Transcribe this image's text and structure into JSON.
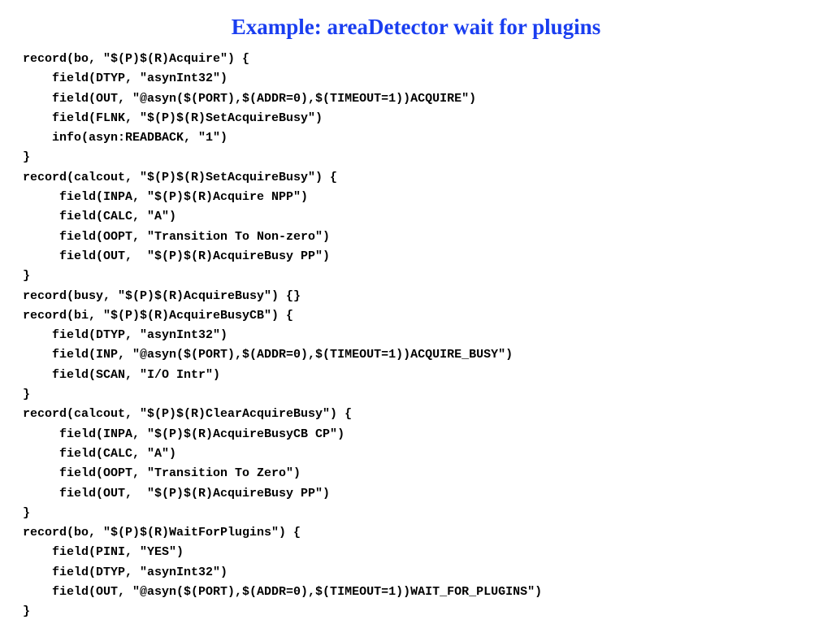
{
  "title": "Example: areaDetector wait for plugins",
  "code": "record(bo, \"$(P)$(R)Acquire\") {\n    field(DTYP, \"asynInt32\")\n    field(OUT, \"@asyn($(PORT),$(ADDR=0),$(TIMEOUT=1))ACQUIRE\")\n    field(FLNK, \"$(P)$(R)SetAcquireBusy\")\n    info(asyn:READBACK, \"1\")\n}\nrecord(calcout, \"$(P)$(R)SetAcquireBusy\") {\n     field(INPA, \"$(P)$(R)Acquire NPP\")\n     field(CALC, \"A\")\n     field(OOPT, \"Transition To Non-zero\")\n     field(OUT,  \"$(P)$(R)AcquireBusy PP\")\n}\nrecord(busy, \"$(P)$(R)AcquireBusy\") {}\nrecord(bi, \"$(P)$(R)AcquireBusyCB\") {\n    field(DTYP, \"asynInt32\")\n    field(INP, \"@asyn($(PORT),$(ADDR=0),$(TIMEOUT=1))ACQUIRE_BUSY\")\n    field(SCAN, \"I/O Intr\")\n}\nrecord(calcout, \"$(P)$(R)ClearAcquireBusy\") {\n     field(INPA, \"$(P)$(R)AcquireBusyCB CP\")\n     field(CALC, \"A\")\n     field(OOPT, \"Transition To Zero\")\n     field(OUT,  \"$(P)$(R)AcquireBusy PP\")\n}\nrecord(bo, \"$(P)$(R)WaitForPlugins\") {\n    field(PINI, \"YES\")\n    field(DTYP, \"asynInt32\")\n    field(OUT, \"@asyn($(PORT),$(ADDR=0),$(TIMEOUT=1))WAIT_FOR_PLUGINS\")\n}"
}
